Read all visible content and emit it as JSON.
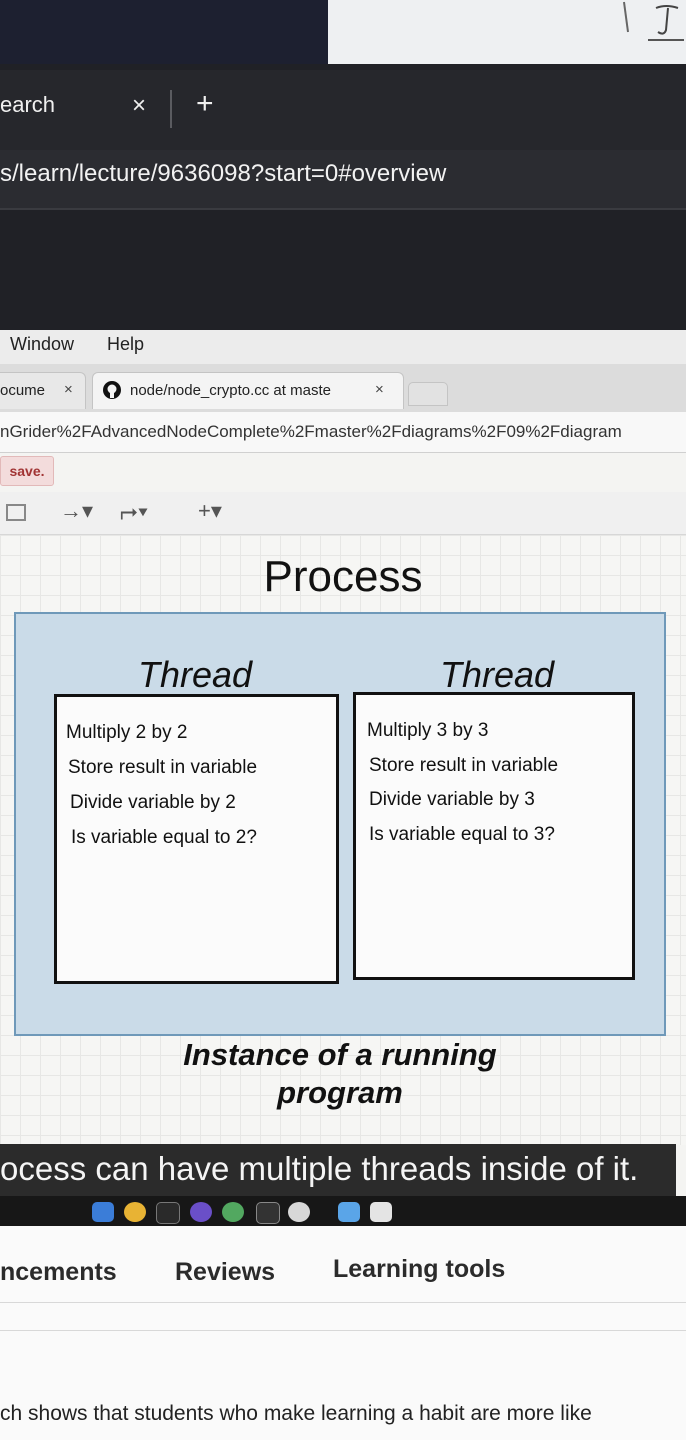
{
  "browser": {
    "tab_title": "earch",
    "tab_close": "×",
    "new_tab": "+",
    "url": "s/learn/lecture/9636098?start=0#overview"
  },
  "menubar": {
    "window": "Window",
    "help": "Help"
  },
  "tabs": [
    {
      "label": "ocume",
      "close": "×"
    },
    {
      "label": "node/node_crypto.cc at maste",
      "close": "×"
    }
  ],
  "address": "nGrider%2FAdvancedNodeComplete%2Fmaster%2Fdiagrams%2F09%2Fdiagram",
  "editor": {
    "save_label": "save.",
    "tools": {
      "arrow": "→▾",
      "connector": "⮣▾",
      "insert": "+▾"
    }
  },
  "diagram": {
    "title": "Process",
    "threads": [
      {
        "title": "Thread",
        "steps": [
          "Multiply 2 by 2",
          "Store result in variable",
          "Divide variable by 2",
          "Is variable equal to 2?"
        ]
      },
      {
        "title": "Thread",
        "steps": [
          "Multiply 3 by 3",
          "Store result in variable",
          "Divide variable by 3",
          "Is variable equal to 3?"
        ]
      }
    ],
    "caption_line1": "Instance of a running",
    "caption_line2": "program"
  },
  "subtitle": "ocess can have multiple threads inside of it.",
  "course_nav": [
    "ncements",
    "Reviews",
    "Learning tools"
  ],
  "body_text": "ch shows that students who make learning a habit are more like",
  "colors": {
    "process_fill": "#cadbe8",
    "process_border": "#6f99b9",
    "save_text": "#a13434"
  }
}
